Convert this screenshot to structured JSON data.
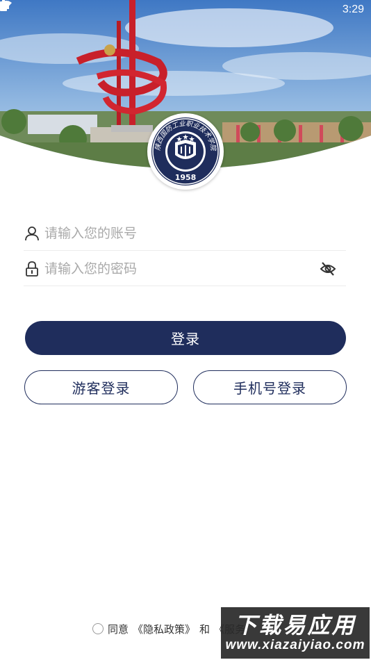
{
  "status_bar": {
    "time": "3:29"
  },
  "emblem": {
    "school_name": "陕西国防工业职业技术学院",
    "year": "1958"
  },
  "login_form": {
    "account_placeholder": "请输入您的账号",
    "password_placeholder": "请输入您的密码",
    "login_button": "登录",
    "guest_login_button": "游客登录",
    "phone_login_button": "手机号登录"
  },
  "agreement": {
    "prefix": "同意",
    "privacy_link": "《隐私政策》",
    "conjunction": "和",
    "service_link_partial": "《服务"
  },
  "watermark": {
    "title": "下载易应用",
    "url": "www.xiazaiyiao.com"
  },
  "colors": {
    "primary": "#1f2d5c",
    "white": "#ffffff"
  }
}
